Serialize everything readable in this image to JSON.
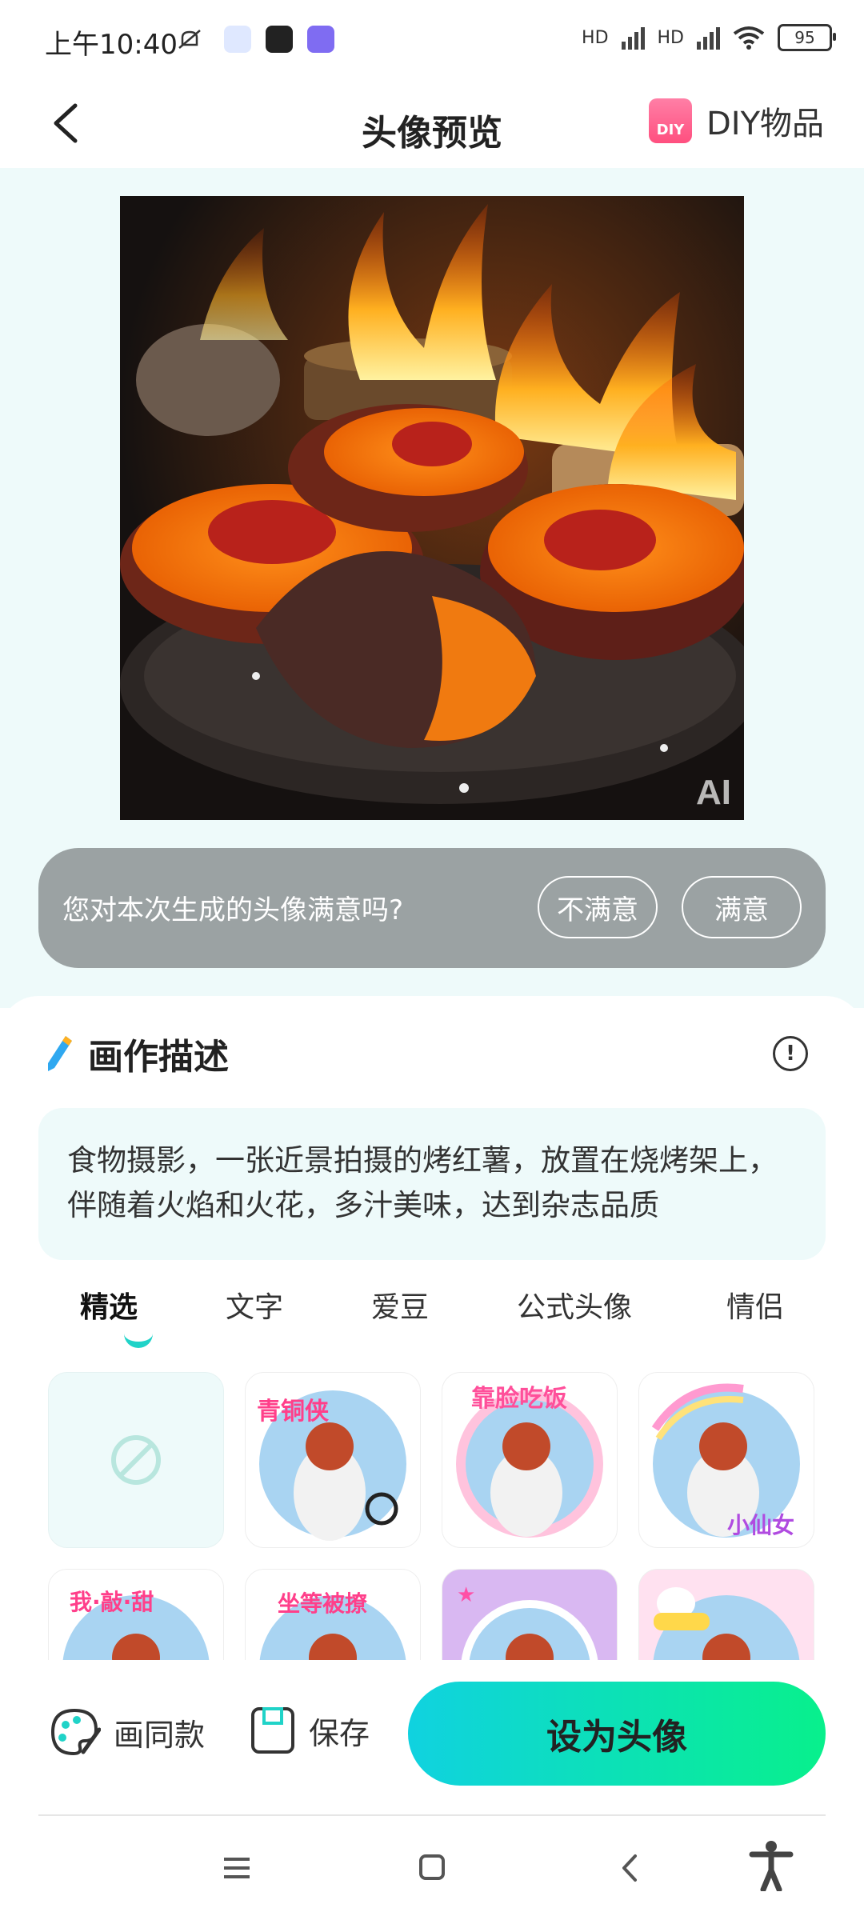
{
  "status_bar": {
    "time": "上午10:40",
    "battery": "95",
    "net1": "HD",
    "net2": "HD"
  },
  "header": {
    "title": "头像预览",
    "diy_badge": "DIY",
    "diy_label": "DIY物品"
  },
  "preview": {
    "watermark": "AI"
  },
  "feedback": {
    "question": "您对本次生成的头像满意吗?",
    "no": "不满意",
    "yes": "满意"
  },
  "section": {
    "title": "画作描述",
    "info_mark": "!"
  },
  "description": "食物摄影，一张近景拍摄的烤红薯，放置在烧烤架上，伴随着火焰和火花，多汁美味，达到杂志品质",
  "tabs": [
    "精选",
    "文字",
    "爱豆",
    "公式头像",
    "情侣"
  ],
  "frames": [
    {
      "text": ""
    },
    {
      "text": "青铜侠"
    },
    {
      "text": "靠脸吃饭"
    },
    {
      "text": "小仙女"
    },
    {
      "text": "我·敲·甜"
    },
    {
      "text": "坐等被撩"
    },
    {
      "text": ""
    },
    {
      "text": ""
    }
  ],
  "actions": {
    "draw_same": "画同款",
    "save": "保存",
    "set_avatar": "设为头像"
  },
  "colors": {
    "accent": "#20d3c8",
    "button_start": "#10d2e0",
    "button_end": "#08f08c",
    "feedback_bg": "#9ba2a3"
  }
}
